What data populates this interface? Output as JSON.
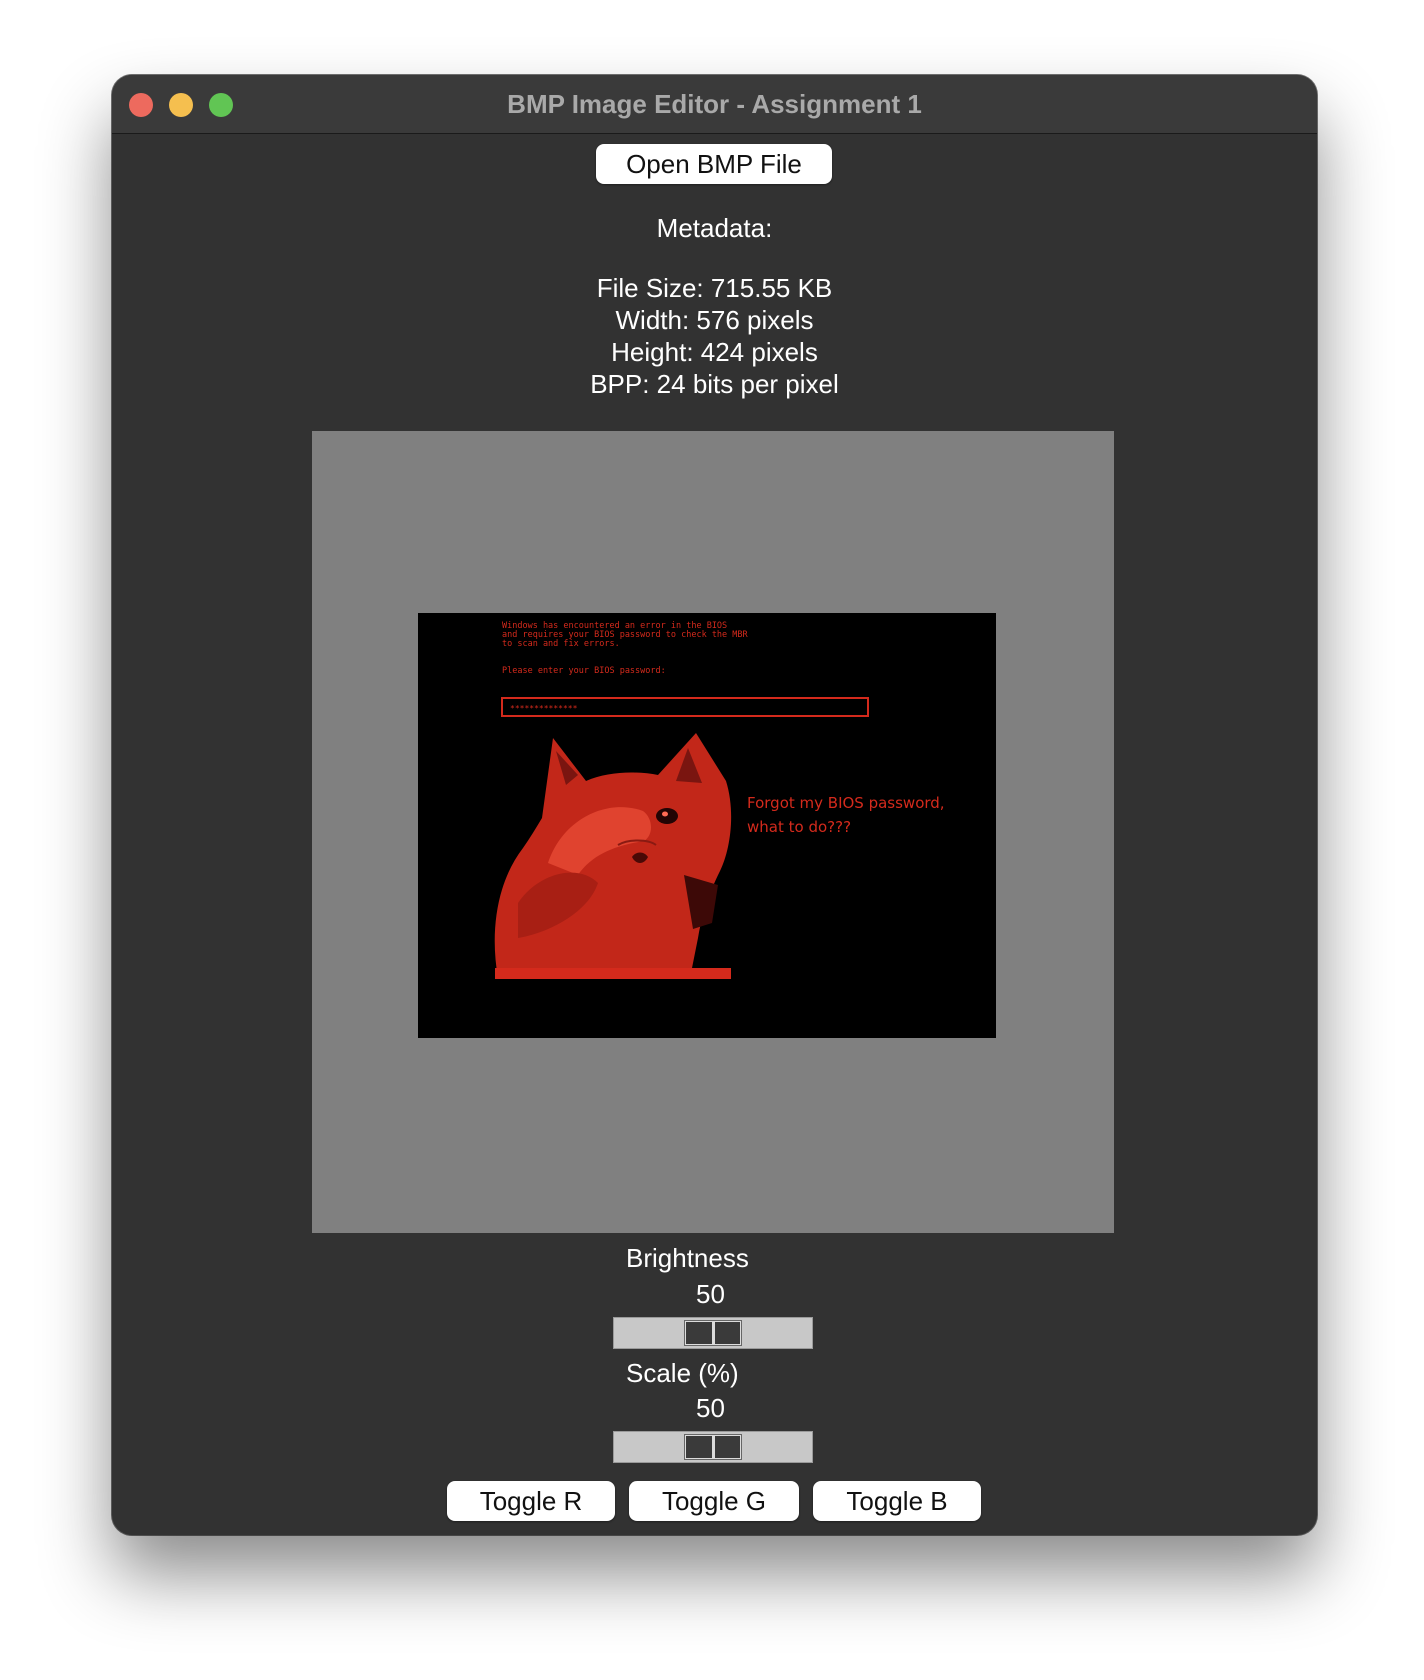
{
  "window": {
    "title": "BMP Image Editor - Assignment 1"
  },
  "toolbar": {
    "open_label": "Open BMP File"
  },
  "metadata": {
    "heading": "Metadata:",
    "file_size": "File Size: 715.55 KB",
    "width": "Width: 576 pixels",
    "height": "Height: 424 pixels",
    "bpp": "BPP: 24 bits per pixel"
  },
  "image_content": {
    "error_lines": [
      "Windows has encountered an error in the BIOS",
      "and requires your BIOS password to check the MBR",
      "to scan and fix errors."
    ],
    "prompt": "Please enter your BIOS password:",
    "password_mask": "**************",
    "caption_line1": "Forgot my BIOS password,",
    "caption_line2": "what to do???"
  },
  "controls": {
    "brightness": {
      "label": "Brightness",
      "value": "50",
      "fraction": 0.5
    },
    "scale": {
      "label": "Scale (%)",
      "value": "50",
      "fraction": 0.5
    },
    "toggles": [
      "Toggle R",
      "Toggle G",
      "Toggle B"
    ]
  },
  "colors": {
    "window_bg": "#323232",
    "canvas_bg": "#808080",
    "image_red": "#d42a1c"
  }
}
